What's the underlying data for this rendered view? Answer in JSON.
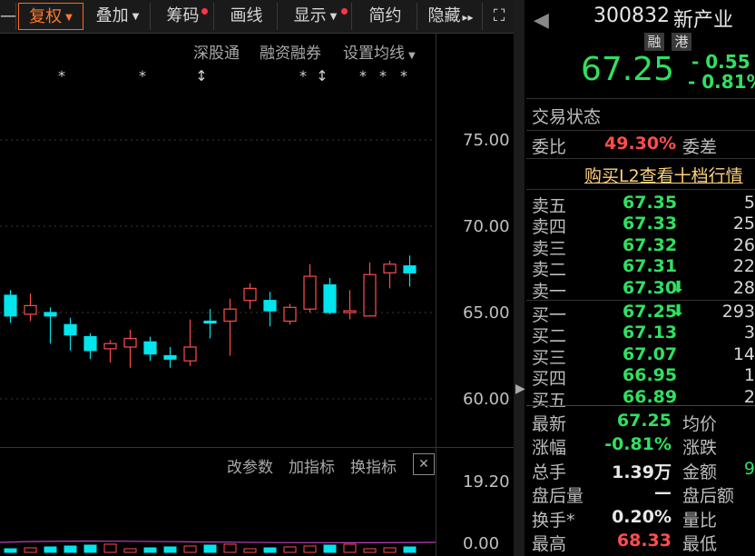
{
  "toolbar": {
    "items": [
      {
        "label": "—",
        "caret": false,
        "dot": false
      },
      {
        "label": "复权",
        "caret": true,
        "dot": false,
        "active": true
      },
      {
        "label": "叠加",
        "caret": true,
        "dot": false
      },
      {
        "label": "筹码",
        "caret": false,
        "dot": true
      },
      {
        "label": "画线",
        "caret": false,
        "dot": false
      },
      {
        "label": "显示",
        "caret": true,
        "dot": true
      },
      {
        "label": "简约",
        "caret": false,
        "dot": false
      },
      {
        "label": "隐藏",
        "caret": false,
        "dot": false
      }
    ],
    "more_glyph": "▸▸",
    "expand_glyph": "⛶"
  },
  "chart": {
    "top_links": [
      "深股通",
      "融资融券",
      "设置均线"
    ],
    "price_levels": [
      "75.00",
      "70.00",
      "65.00",
      "60.00"
    ],
    "indicator_links": [
      "改参数",
      "加指标",
      "换指标"
    ],
    "indicator_close": "✕",
    "volume_levels": [
      "19.20",
      "0.00"
    ],
    "markers": [
      "*",
      "*",
      "↕",
      "*",
      "↕",
      "*",
      "*",
      "*"
    ],
    "candles": [
      {
        "o": 64.8,
        "c": 66.0,
        "h": 66.3,
        "l": 64.4,
        "up": false
      },
      {
        "o": 65.4,
        "c": 64.9,
        "h": 66.1,
        "l": 64.5,
        "up": true
      },
      {
        "o": 65.0,
        "c": 64.8,
        "h": 65.3,
        "l": 63.2,
        "up": false
      },
      {
        "o": 64.3,
        "c": 63.7,
        "h": 64.7,
        "l": 62.8,
        "up": false
      },
      {
        "o": 63.6,
        "c": 62.8,
        "h": 63.8,
        "l": 62.3,
        "up": false
      },
      {
        "o": 62.9,
        "c": 63.2,
        "h": 63.4,
        "l": 62.1,
        "up": true
      },
      {
        "o": 63.0,
        "c": 63.5,
        "h": 64.0,
        "l": 61.8,
        "up": true
      },
      {
        "o": 63.3,
        "c": 62.6,
        "h": 63.6,
        "l": 62.2,
        "up": false
      },
      {
        "o": 62.5,
        "c": 62.3,
        "h": 63.0,
        "l": 61.8,
        "up": false
      },
      {
        "o": 62.2,
        "c": 63.0,
        "h": 64.6,
        "l": 61.9,
        "up": true
      },
      {
        "o": 64.5,
        "c": 64.4,
        "h": 65.2,
        "l": 63.5,
        "up": false
      },
      {
        "o": 64.5,
        "c": 65.2,
        "h": 65.8,
        "l": 62.5,
        "up": true
      },
      {
        "o": 65.7,
        "c": 66.4,
        "h": 66.7,
        "l": 65.2,
        "up": true
      },
      {
        "o": 65.7,
        "c": 65.1,
        "h": 66.2,
        "l": 64.2,
        "up": false
      },
      {
        "o": 64.5,
        "c": 65.3,
        "h": 65.5,
        "l": 64.3,
        "up": true
      },
      {
        "o": 65.2,
        "c": 67.1,
        "h": 67.8,
        "l": 65.0,
        "up": true
      },
      {
        "o": 66.6,
        "c": 65.0,
        "h": 67.0,
        "l": 64.9,
        "up": false
      },
      {
        "o": 65.0,
        "c": 65.1,
        "h": 66.3,
        "l": 64.6,
        "up": true
      },
      {
        "o": 64.8,
        "c": 67.2,
        "h": 67.9,
        "l": 64.8,
        "up": true
      },
      {
        "o": 67.3,
        "c": 67.8,
        "h": 68.0,
        "l": 66.4,
        "up": true
      },
      {
        "o": 67.7,
        "c": 67.3,
        "h": 68.3,
        "l": 66.5,
        "up": false
      }
    ]
  },
  "quote": {
    "code": "300832",
    "name": "新产业",
    "tag1": "融",
    "tag2": "港",
    "price": "67.25",
    "change": "- 0.55",
    "change_pct": "- 0.81%",
    "trade_status_label": "交易状态",
    "weibi_label": "委比",
    "weibi_value": "49.30%",
    "weicha_label": "委差",
    "l2_link": "购买L2查看十档行情"
  },
  "orderbook": {
    "asks": [
      {
        "label": "卖五",
        "price": "67.35",
        "vol": "5",
        "arrow": ""
      },
      {
        "label": "卖四",
        "price": "67.33",
        "vol": "25",
        "arrow": ""
      },
      {
        "label": "卖三",
        "price": "67.32",
        "vol": "26",
        "arrow": ""
      },
      {
        "label": "卖二",
        "price": "67.31",
        "vol": "22",
        "arrow": ""
      },
      {
        "label": "卖一",
        "price": "67.30",
        "vol": "28",
        "arrow": "⬇"
      }
    ],
    "bids": [
      {
        "label": "买一",
        "price": "67.25",
        "vol": "293",
        "arrow": "⬇"
      },
      {
        "label": "买二",
        "price": "67.13",
        "vol": "3",
        "arrow": ""
      },
      {
        "label": "买三",
        "price": "67.07",
        "vol": "14",
        "arrow": ""
      },
      {
        "label": "买四",
        "price": "66.95",
        "vol": "1",
        "arrow": ""
      },
      {
        "label": "买五",
        "price": "66.89",
        "vol": "2",
        "arrow": ""
      }
    ]
  },
  "stats": [
    {
      "l1": "最新",
      "v1": "67.25",
      "v1_color": "green",
      "l2": "均价",
      "v2": ""
    },
    {
      "l1": "涨幅",
      "v1": "-0.81%",
      "v1_color": "green",
      "l2": "涨跌",
      "v2": ""
    },
    {
      "l1": "总手",
      "v1": "1.39万",
      "v1_color": "white",
      "l2": "金额",
      "v2": "9"
    },
    {
      "l1": "盘后量",
      "v1": "—",
      "v1_color": "white",
      "l2": "盘后额",
      "v2": ""
    },
    {
      "l1": "换手*",
      "v1": "0.20%",
      "v1_color": "white",
      "l2": "量比",
      "v2": ""
    },
    {
      "l1": "最高",
      "v1": "68.33",
      "v1_color": "red",
      "l2": "最低",
      "v2": ""
    }
  ],
  "colors": {
    "up": "#ff4d4d",
    "down": "#00e5ee",
    "accent": "#ff6a1a",
    "link": "#ffd27a"
  }
}
